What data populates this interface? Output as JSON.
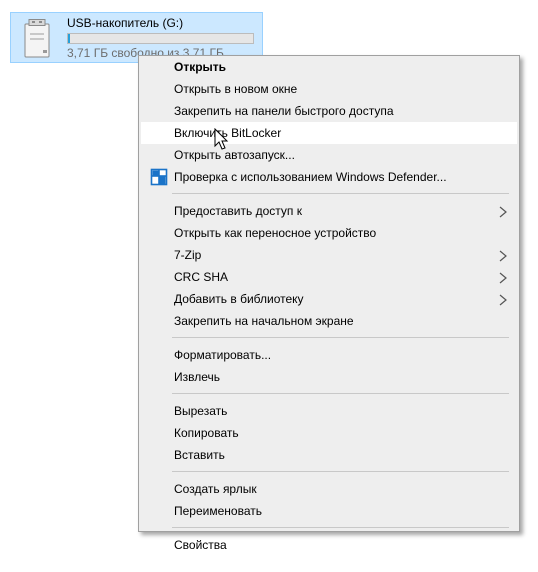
{
  "drive": {
    "title": "USB-накопитель (G:)",
    "free_text": "3,71 ГБ свободно из 3,71 ГБ",
    "usage_fraction": 0.01,
    "bar_color": "#26a0da",
    "icon": "usb-drive-icon"
  },
  "menu": {
    "items": [
      {
        "id": "open",
        "label": "Открыть",
        "bold": true
      },
      {
        "id": "open-new-window",
        "label": "Открыть в новом окне"
      },
      {
        "id": "pin-quick-access",
        "label": "Закрепить на панели быстрого доступа"
      },
      {
        "id": "bitlocker",
        "label": "Включить BitLocker",
        "hover": true
      },
      {
        "id": "autoplay",
        "label": "Открыть автозапуск..."
      },
      {
        "id": "defender",
        "label": "Проверка с использованием Windows Defender...",
        "icon": "windows-defender-icon"
      },
      {
        "sep": true
      },
      {
        "id": "share",
        "label": "Предоставить доступ к",
        "submenu": true
      },
      {
        "id": "portable-device",
        "label": "Открыть как переносное устройство"
      },
      {
        "id": "7zip",
        "label": "7-Zip",
        "submenu": true
      },
      {
        "id": "crc-sha",
        "label": "CRC SHA",
        "submenu": true
      },
      {
        "id": "add-library",
        "label": "Добавить в библиотеку",
        "submenu": true
      },
      {
        "id": "pin-start",
        "label": "Закрепить на начальном экране"
      },
      {
        "sep": true
      },
      {
        "id": "format",
        "label": "Форматировать..."
      },
      {
        "id": "eject",
        "label": "Извлечь"
      },
      {
        "sep": true
      },
      {
        "id": "cut",
        "label": "Вырезать"
      },
      {
        "id": "copy",
        "label": "Копировать"
      },
      {
        "id": "paste",
        "label": "Вставить"
      },
      {
        "sep": true
      },
      {
        "id": "create-shortcut",
        "label": "Создать ярлык"
      },
      {
        "id": "rename",
        "label": "Переименовать"
      },
      {
        "sep": true
      },
      {
        "id": "properties",
        "label": "Свойства"
      }
    ],
    "colors": {
      "hover_bg": "#ffffff",
      "menu_bg": "#eeeeee",
      "separator": "#c8c8c8"
    }
  }
}
